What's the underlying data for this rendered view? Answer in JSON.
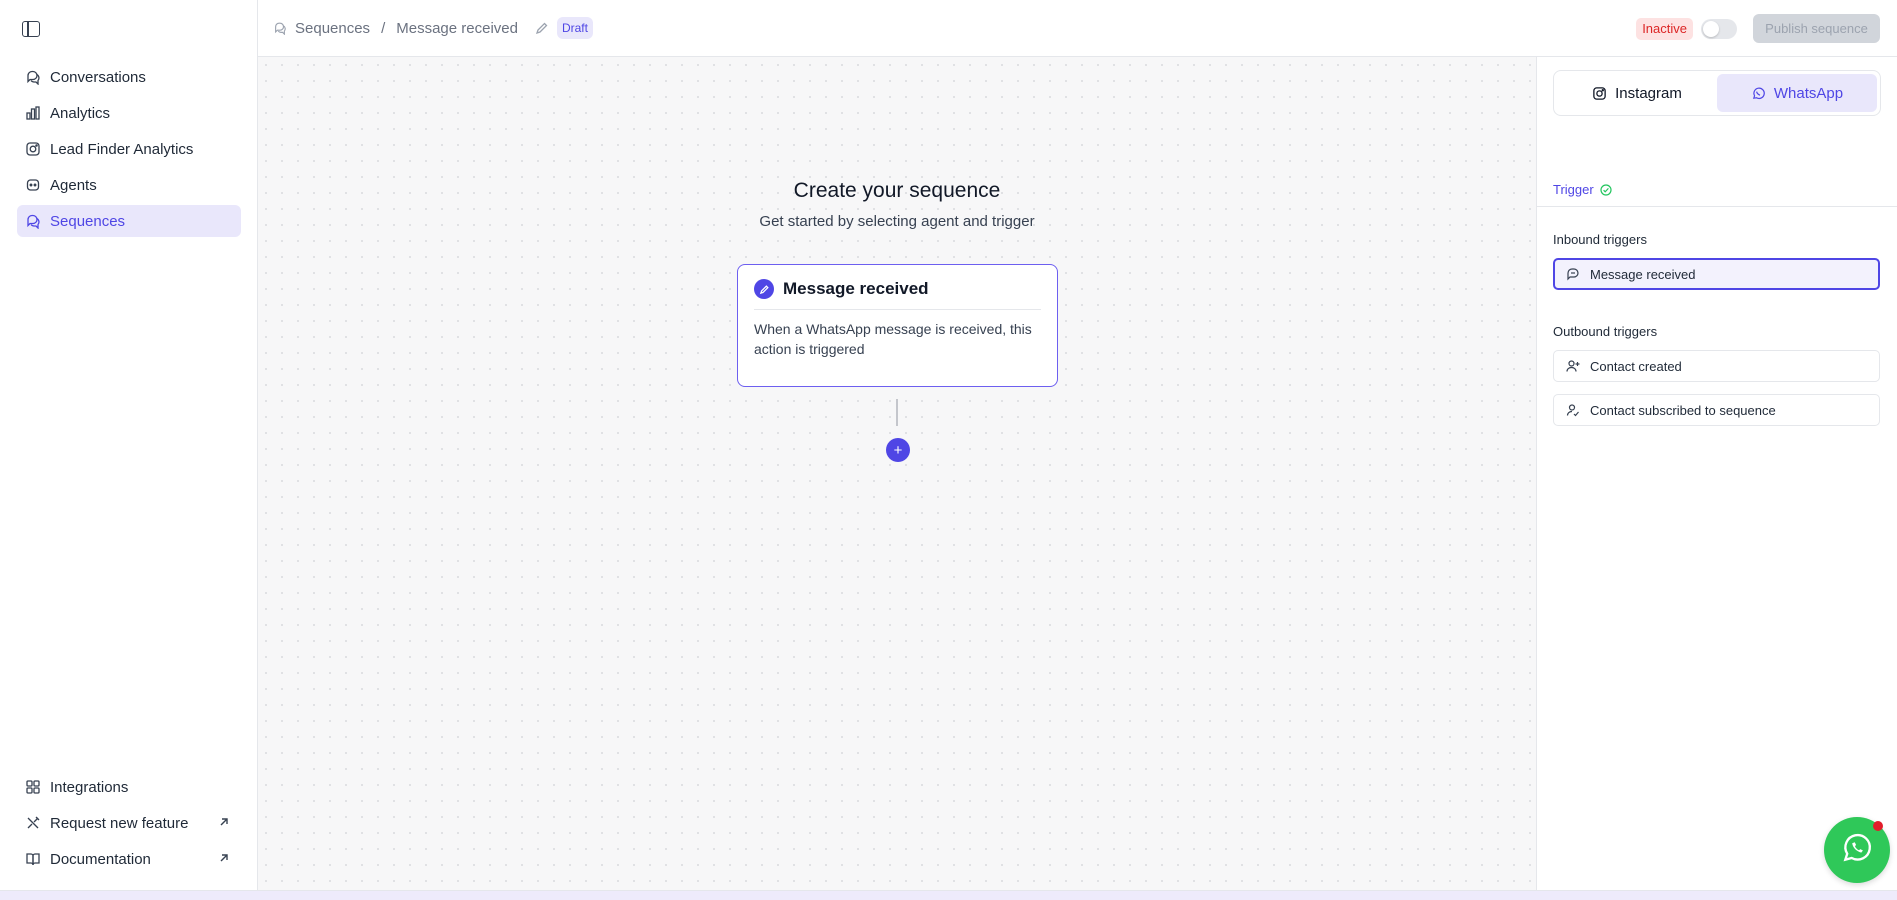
{
  "sidebar": {
    "toggle_icon": "sidebar-panel-icon",
    "items": [
      {
        "label": "Conversations",
        "icon": "chat-bubbles-icon",
        "active": false
      },
      {
        "label": "Analytics",
        "icon": "bar-chart-icon",
        "active": false
      },
      {
        "label": "Lead Finder Analytics",
        "icon": "instagram-icon",
        "active": false
      },
      {
        "label": "Agents",
        "icon": "bot-icon",
        "active": false
      },
      {
        "label": "Sequences",
        "icon": "sequence-icon",
        "active": true
      }
    ],
    "bottom_items": [
      {
        "label": "Integrations",
        "icon": "grid-icon"
      },
      {
        "label": "Request new feature",
        "icon": "tools-icon",
        "external": true
      },
      {
        "label": "Documentation",
        "icon": "book-icon",
        "external": true
      }
    ]
  },
  "header": {
    "breadcrumb": [
      "Sequences",
      "Message received"
    ],
    "separator": "/",
    "draft_badge": "Draft",
    "status_badge": "Inactive",
    "publish_label": "Publish sequence"
  },
  "canvas": {
    "title": "Create your sequence",
    "subtitle": "Get started by selecting agent and trigger",
    "card": {
      "title": "Message received",
      "description": "When a WhatsApp message is received, this action is triggered"
    },
    "add_symbol": "+"
  },
  "panel": {
    "channels": [
      {
        "label": "Instagram",
        "icon": "instagram-icon",
        "active": false
      },
      {
        "label": "WhatsApp",
        "icon": "whatsapp-icon",
        "active": true
      }
    ],
    "trigger_tab": "Trigger",
    "inbound_label": "Inbound triggers",
    "inbound": [
      {
        "label": "Message received",
        "icon": "message-icon",
        "selected": true
      }
    ],
    "outbound_label": "Outbound triggers",
    "outbound": [
      {
        "label": "Contact created",
        "icon": "user-plus-icon"
      },
      {
        "label": "Contact subscribed to sequence",
        "icon": "user-check-icon"
      }
    ]
  },
  "colors": {
    "accent": "#4f46e5",
    "accent_soft": "#e9e7fb",
    "inactive": "#dc2626",
    "whatsapp": "#2fc859"
  }
}
